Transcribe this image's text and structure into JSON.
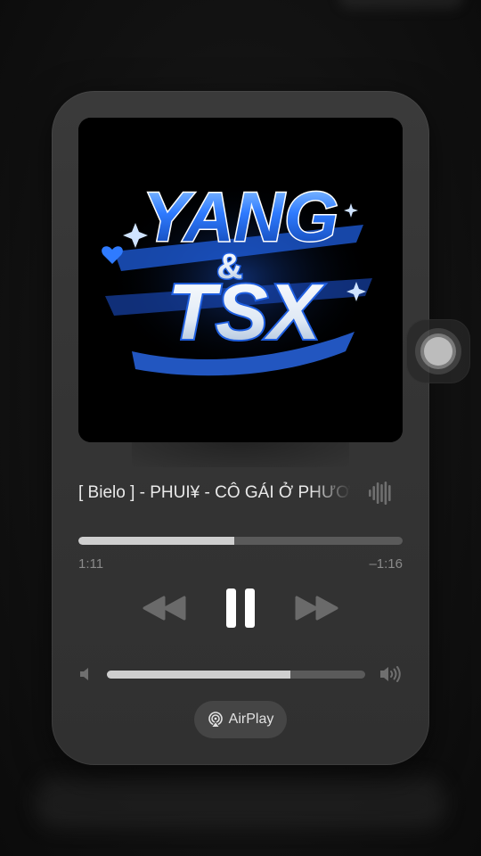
{
  "player": {
    "track_title": "[ Bielo ] - PHUI¥ - CÔ GÁI Ở PHƯƠNG XA",
    "elapsed": "1:11",
    "remaining": "–1:16",
    "progress_fraction": 0.48,
    "volume_fraction": 0.71,
    "airplay_label": "AirPlay",
    "artwork": {
      "line1": "YANG",
      "amp": "&",
      "line2": "TSX"
    }
  },
  "icons": {
    "now_playing": "waveform-icon",
    "rewind": "backward-icon",
    "play_pause": "pause-icon",
    "forward": "forward-icon",
    "volume_low": "speaker-low-icon",
    "volume_high": "speaker-high-icon",
    "airplay": "airplay-icon",
    "assistive_touch": "assistive-touch-icon"
  },
  "colors": {
    "card": "#353535",
    "accent_blue": "#2f7bff",
    "track_fill": "#cfcfcf",
    "track_bg": "#5a5a5a"
  }
}
